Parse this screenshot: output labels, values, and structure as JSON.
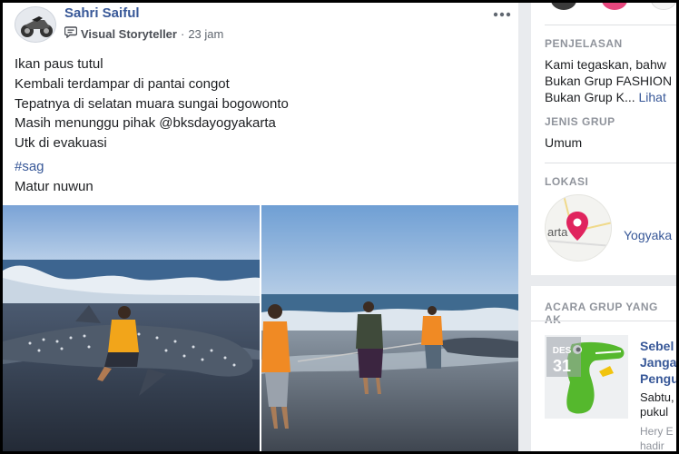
{
  "post": {
    "author": "Sahri Saiful",
    "badge_label": "Visual Storyteller",
    "separator": "·",
    "time": "23 jam",
    "lines": [
      "Ikan paus tutul",
      "Kembali terdampar di pantai congot",
      "Tepatnya di selatan muara sungai bogowonto",
      "Masih menunggu pihak @bksdayogyakarta",
      "Utk di evakuasi"
    ],
    "hashtag": "#sag",
    "signoff": "Matur nuwun",
    "more_icon": "more-horizontal-icon",
    "badge_icon": "speech-bubble-icon"
  },
  "sidebar": {
    "description_heading": "PENJELASAN",
    "description_lines": [
      "Kami tegaskan, bahw",
      "Bukan Grup FASHION",
      "Bukan Grup K..."
    ],
    "see_more": "Lihat",
    "type_heading": "JENIS GRUP",
    "type_value": "Umum",
    "location_heading": "LOKASI",
    "map_label": "arta",
    "location_value": "Yogyaka",
    "events_heading": "ACARA GRUP YANG AK",
    "event": {
      "month": "DES",
      "day": "31",
      "title_lines": [
        "Sebel",
        "Janga",
        "Pengu"
      ],
      "time_lines": [
        "Sabtu,",
        "pukul"
      ],
      "host_lines": [
        "Hery E",
        "hadir"
      ]
    }
  },
  "colors": {
    "link": "#385898",
    "map_pin": "#e0245e",
    "crocodile": "#55b82d"
  }
}
